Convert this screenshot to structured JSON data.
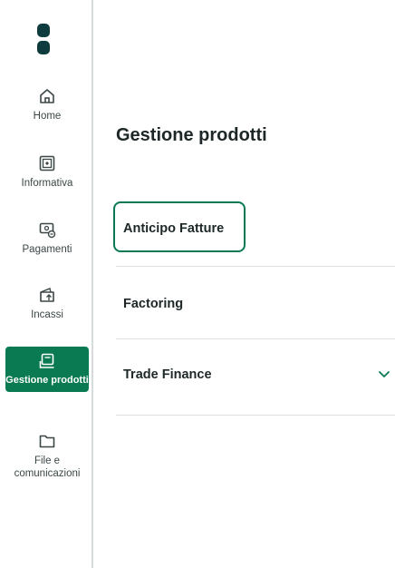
{
  "colors": {
    "brand_dark": "#0d3b3e",
    "accent_green": "#0a7a52",
    "divider": "#dfe3e3"
  },
  "sidebar": {
    "items": [
      {
        "label": "Home",
        "icon": "home-icon"
      },
      {
        "label": "Informativa",
        "icon": "safe-icon"
      },
      {
        "label": "Pagamenti",
        "icon": "payments-icon"
      },
      {
        "label": "Incassi",
        "icon": "wallet-in-icon"
      },
      {
        "label": "Gestione prodotti",
        "icon": "products-icon",
        "active": true
      },
      {
        "label": "File e comunicazioni",
        "icon": "folder-icon"
      }
    ]
  },
  "main": {
    "title": "Gestione prodotti",
    "products": [
      {
        "label": "Anticipo Fatture",
        "selected": true
      },
      {
        "label": "Factoring"
      },
      {
        "label": "Trade Finance",
        "expandable": true,
        "icon": "chevron-down-icon"
      }
    ]
  }
}
